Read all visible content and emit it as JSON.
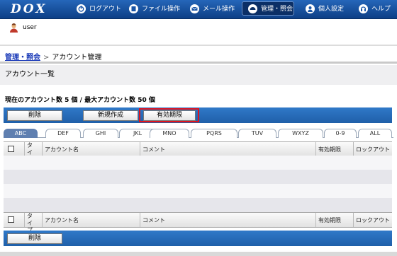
{
  "app": {
    "logo": "DOX"
  },
  "nav": {
    "logout": "ログアウト",
    "file_ops": "ファイル操作",
    "mail_ops": "メール操作",
    "admin": "管理・照会",
    "personal": "個人設定",
    "help": "ヘルプ"
  },
  "user": {
    "name": "user"
  },
  "breadcrumb": {
    "parent": "管理・照会",
    "separator": ">",
    "current": "アカウント管理"
  },
  "section": {
    "title": "アカウント一覧",
    "count_line": "現在のアカウント数 5 個 / 最大アカウント数 50 個"
  },
  "toolbar": {
    "delete": "削除",
    "create": "新規作成",
    "expiry": "有効期限"
  },
  "tabs": [
    "ABC",
    "DEF",
    "GHI",
    "JKL",
    "MNO",
    "PQRS",
    "TUV",
    "WXYZ",
    "0-9",
    "ALL"
  ],
  "active_tab": "ABC",
  "table": {
    "headers": {
      "type": "タイプ",
      "account": "アカウント名",
      "comment": "コメント",
      "expiry": "有効期限",
      "lockout": "ロックアウト"
    }
  },
  "bottom_toolbar": {
    "delete": "削除"
  },
  "colors": {
    "nav": "#1a55a6",
    "highlight": "#e0141e",
    "active_tab": "#5f7fb0"
  }
}
